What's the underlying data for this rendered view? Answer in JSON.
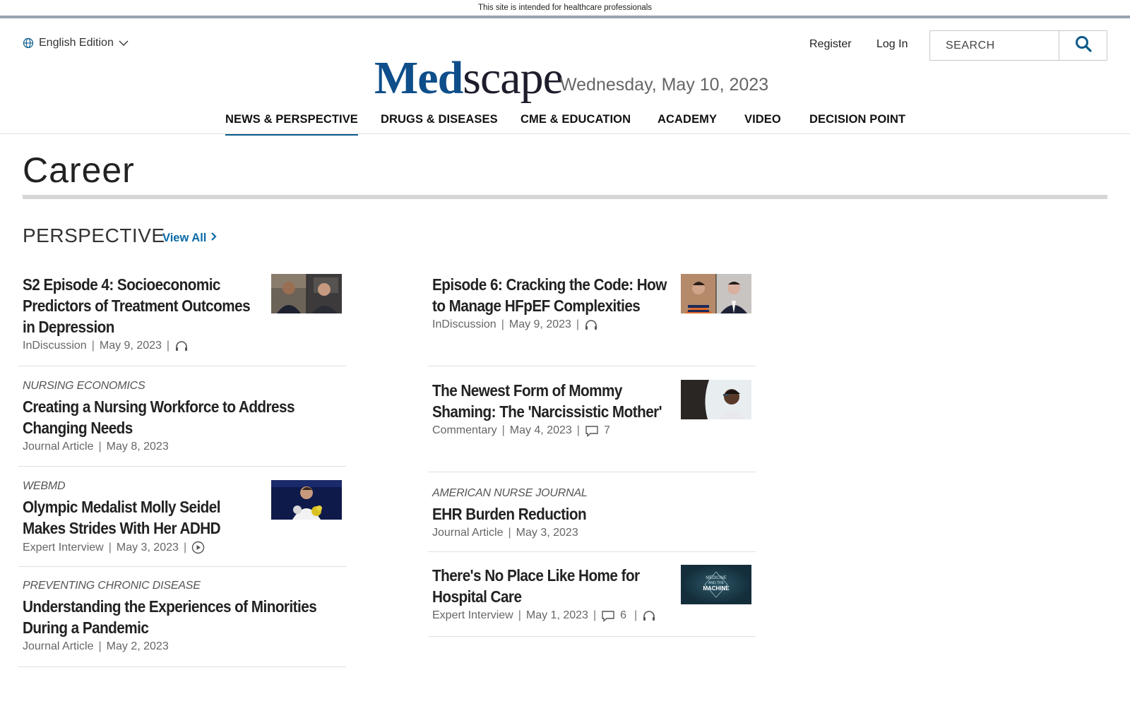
{
  "topbar": {
    "notice": "This site is intended for healthcare professionals"
  },
  "header": {
    "edition": "English Edition",
    "register": "Register",
    "login": "Log In",
    "search_placeholder": "SEARCH",
    "logo_med": "Med",
    "logo_scape": "scape",
    "date": "Wednesday, May 10, 2023"
  },
  "nav": [
    {
      "label": "NEWS & PERSPECTIVE",
      "active": true
    },
    {
      "label": "DRUGS & DISEASES"
    },
    {
      "label": "CME & EDUCATION"
    },
    {
      "label": "ACADEMY"
    },
    {
      "label": "VIDEO"
    },
    {
      "label": "DECISION POINT"
    }
  ],
  "page": {
    "title": "Career",
    "section": "PERSPECTIVE",
    "view_all": "View All"
  },
  "articles": {
    "a1": {
      "title": "S2 Episode 4: Socioeconomic Predictors of Treatment Outcomes in Depression",
      "type": "InDiscussion",
      "date": "May 9, 2023",
      "icon": "headphones-icon"
    },
    "a2": {
      "source": "NURSING ECONOMICS",
      "title": "Creating a Nursing Workforce to Address Changing Needs",
      "type": "Journal Article",
      "date": "May 8, 2023"
    },
    "a3": {
      "source": "WEBMD",
      "title": "Olympic Medalist Molly Seidel Makes Strides With Her ADHD",
      "type": "Expert Interview",
      "date": "May 3, 2023",
      "icon": "play-icon"
    },
    "a4": {
      "source": "PREVENTING CHRONIC DISEASE",
      "title": "Understanding the Experiences of Minorities During a Pandemic",
      "type": "Journal Article",
      "date": "May 2, 2023"
    },
    "b1": {
      "title": "Episode 6: Cracking the Code: How to Manage HFpEF Complexities",
      "type": "InDiscussion",
      "date": "May 9, 2023",
      "icon": "headphones-icon"
    },
    "b2": {
      "title": "The Newest Form of Mommy Shaming: The 'Narcissistic Mother'",
      "type": "Commentary",
      "date": "May 4, 2023",
      "comments": "7"
    },
    "b3": {
      "source": "AMERICAN NURSE JOURNAL",
      "title": "EHR Burden Reduction",
      "type": "Journal Article",
      "date": "May 3, 2023"
    },
    "b4": {
      "title": "There's No Place Like Home for Hospital Care",
      "type": "Expert Interview",
      "date": "May 1, 2023",
      "comments": "6",
      "icon": "headphones-icon",
      "thumb_text_1": "MEDICINE",
      "thumb_text_2": "AND THE",
      "thumb_text_3": "MACHINE"
    }
  },
  "colors": {
    "accent": "#0a5a8a",
    "link": "#0a6aa8",
    "logo_blue": "#0e4e8a"
  }
}
